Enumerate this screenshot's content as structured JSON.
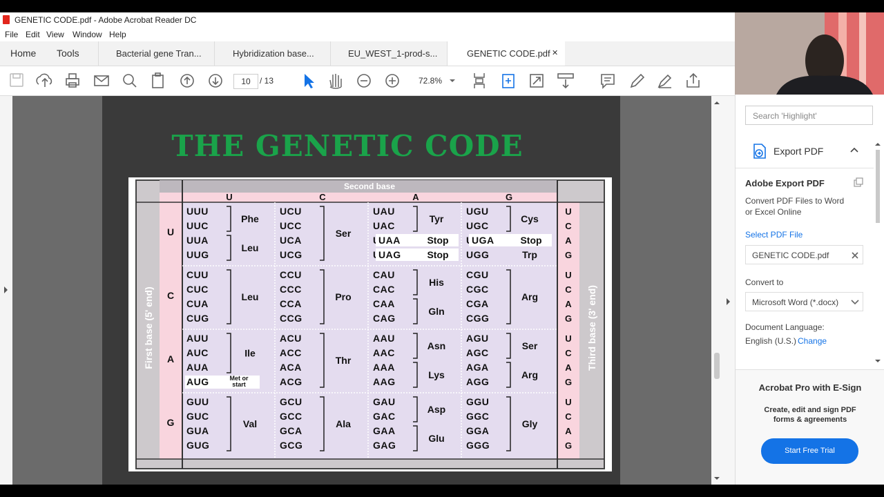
{
  "window": {
    "title": "GENETIC CODE.pdf - Adobe Acrobat Reader DC",
    "menu": [
      "File",
      "Edit",
      "View",
      "Window",
      "Help"
    ]
  },
  "tabs": {
    "home": "Home",
    "tools": "Tools",
    "docs": [
      "Bacterial gene Tran...",
      "Hybridization base...",
      "EU_WEST_1-prod-s...",
      "GENETIC CODE.pdf"
    ],
    "close": "✕"
  },
  "toolbar": {
    "page_current": "10",
    "page_total": "/  13",
    "zoom": "72.8%"
  },
  "page": {
    "title": "THE GENETIC CODE",
    "second_base_label": "Second base",
    "first_base_label": "First base  (5' end)",
    "third_base_label": "Third base  (3' end)",
    "second_bases": [
      "U",
      "C",
      "A",
      "G"
    ],
    "first_bases": [
      "U",
      "C",
      "A",
      "G"
    ],
    "third_bases": [
      "U",
      "C",
      "A",
      "G"
    ],
    "columns": [
      {
        "base": "U",
        "blocks": [
          {
            "codons": [
              "UUU",
              "UUC",
              "UUA",
              "UUG"
            ],
            "groups": [
              {
                "rows": [
                  0,
                  1
                ],
                "aa": "Phe"
              },
              {
                "rows": [
                  2,
                  3
                ],
                "aa": "Leu"
              }
            ]
          },
          {
            "codons": [
              "CUU",
              "CUC",
              "CUA",
              "CUG"
            ],
            "groups": [
              {
                "rows": [
                  0,
                  3
                ],
                "aa": "Leu"
              }
            ]
          },
          {
            "codons": [
              "AUU",
              "AUC",
              "AUA",
              "AUG"
            ],
            "groups": [
              {
                "rows": [
                  0,
                  2
                ],
                "aa": "Ile"
              }
            ],
            "special": {
              "row": 3,
              "text1": "Met or",
              "text2": "start"
            }
          },
          {
            "codons": [
              "GUU",
              "GUC",
              "GUA",
              "GUG"
            ],
            "groups": [
              {
                "rows": [
                  0,
                  3
                ],
                "aa": "Val"
              }
            ]
          }
        ]
      },
      {
        "base": "C",
        "blocks": [
          {
            "codons": [
              "UCU",
              "UCC",
              "UCA",
              "UCG"
            ],
            "groups": [
              {
                "rows": [
                  0,
                  3
                ],
                "aa": "Ser"
              }
            ]
          },
          {
            "codons": [
              "CCU",
              "CCC",
              "CCA",
              "CCG"
            ],
            "groups": [
              {
                "rows": [
                  0,
                  3
                ],
                "aa": "Pro"
              }
            ]
          },
          {
            "codons": [
              "ACU",
              "ACC",
              "ACA",
              "ACG"
            ],
            "groups": [
              {
                "rows": [
                  0,
                  3
                ],
                "aa": "Thr"
              }
            ]
          },
          {
            "codons": [
              "GCU",
              "GCC",
              "GCA",
              "GCG"
            ],
            "groups": [
              {
                "rows": [
                  0,
                  3
                ],
                "aa": "Ala"
              }
            ]
          }
        ]
      },
      {
        "base": "A",
        "blocks": [
          {
            "codons": [
              "UAU",
              "UAC",
              "UAA",
              "UAG"
            ],
            "groups": [
              {
                "rows": [
                  0,
                  1
                ],
                "aa": "Tyr"
              }
            ],
            "stops": [
              {
                "row": 2,
                "aa": "Stop"
              },
              {
                "row": 3,
                "aa": "Stop"
              }
            ]
          },
          {
            "codons": [
              "CAU",
              "CAC",
              "CAA",
              "CAG"
            ],
            "groups": [
              {
                "rows": [
                  0,
                  1
                ],
                "aa": "His"
              },
              {
                "rows": [
                  2,
                  3
                ],
                "aa": "Gln"
              }
            ]
          },
          {
            "codons": [
              "AAU",
              "AAC",
              "AAA",
              "AAG"
            ],
            "groups": [
              {
                "rows": [
                  0,
                  1
                ],
                "aa": "Asn"
              },
              {
                "rows": [
                  2,
                  3
                ],
                "aa": "Lys"
              }
            ]
          },
          {
            "codons": [
              "GAU",
              "GAC",
              "GAA",
              "GAG"
            ],
            "groups": [
              {
                "rows": [
                  0,
                  1
                ],
                "aa": "Asp"
              },
              {
                "rows": [
                  2,
                  3
                ],
                "aa": "Glu"
              }
            ]
          }
        ]
      },
      {
        "base": "G",
        "blocks": [
          {
            "codons": [
              "UGU",
              "UGC",
              "UGA",
              "UGG"
            ],
            "groups": [
              {
                "rows": [
                  0,
                  1
                ],
                "aa": "Cys"
              }
            ],
            "stops": [
              {
                "row": 2,
                "aa": "Stop"
              }
            ],
            "single": [
              {
                "row": 3,
                "aa": "Trp"
              }
            ]
          },
          {
            "codons": [
              "CGU",
              "CGC",
              "CGA",
              "CGG"
            ],
            "groups": [
              {
                "rows": [
                  0,
                  3
                ],
                "aa": "Arg"
              }
            ]
          },
          {
            "codons": [
              "AGU",
              "AGC",
              "AGA",
              "AGG"
            ],
            "groups": [
              {
                "rows": [
                  0,
                  1
                ],
                "aa": "Ser"
              },
              {
                "rows": [
                  2,
                  3
                ],
                "aa": "Arg"
              }
            ]
          },
          {
            "codons": [
              "GGU",
              "GGC",
              "GGA",
              "GGG"
            ],
            "groups": [
              {
                "rows": [
                  0,
                  3
                ],
                "aa": "Gly"
              }
            ]
          }
        ]
      }
    ]
  },
  "sidebar": {
    "search_placeholder": "Search 'Highlight'",
    "export_header": "Export PDF",
    "adobe_export_title": "Adobe Export PDF",
    "desc_line1": "Convert PDF Files to Word",
    "desc_line2": "or Excel Online",
    "select_file": "Select PDF File",
    "file_name": "GENETIC CODE.pdf",
    "convert_to": "Convert to",
    "format": "Microsoft Word (*.docx)",
    "doc_lang_label": "Document Language:",
    "doc_lang_value": "English (U.S.)",
    "change": "Change",
    "promo_title": "Acrobat Pro with E-Sign",
    "promo_line1": "Create, edit and sign PDF",
    "promo_line2": "forms & agreements",
    "start_trial": "Start Free Trial"
  },
  "colors": {
    "accent": "#1473e6",
    "title_green": "#1aa34a",
    "table_pink": "#f9d5de",
    "table_lavender": "#e4dcef",
    "pdf_red": "#e2261c"
  }
}
